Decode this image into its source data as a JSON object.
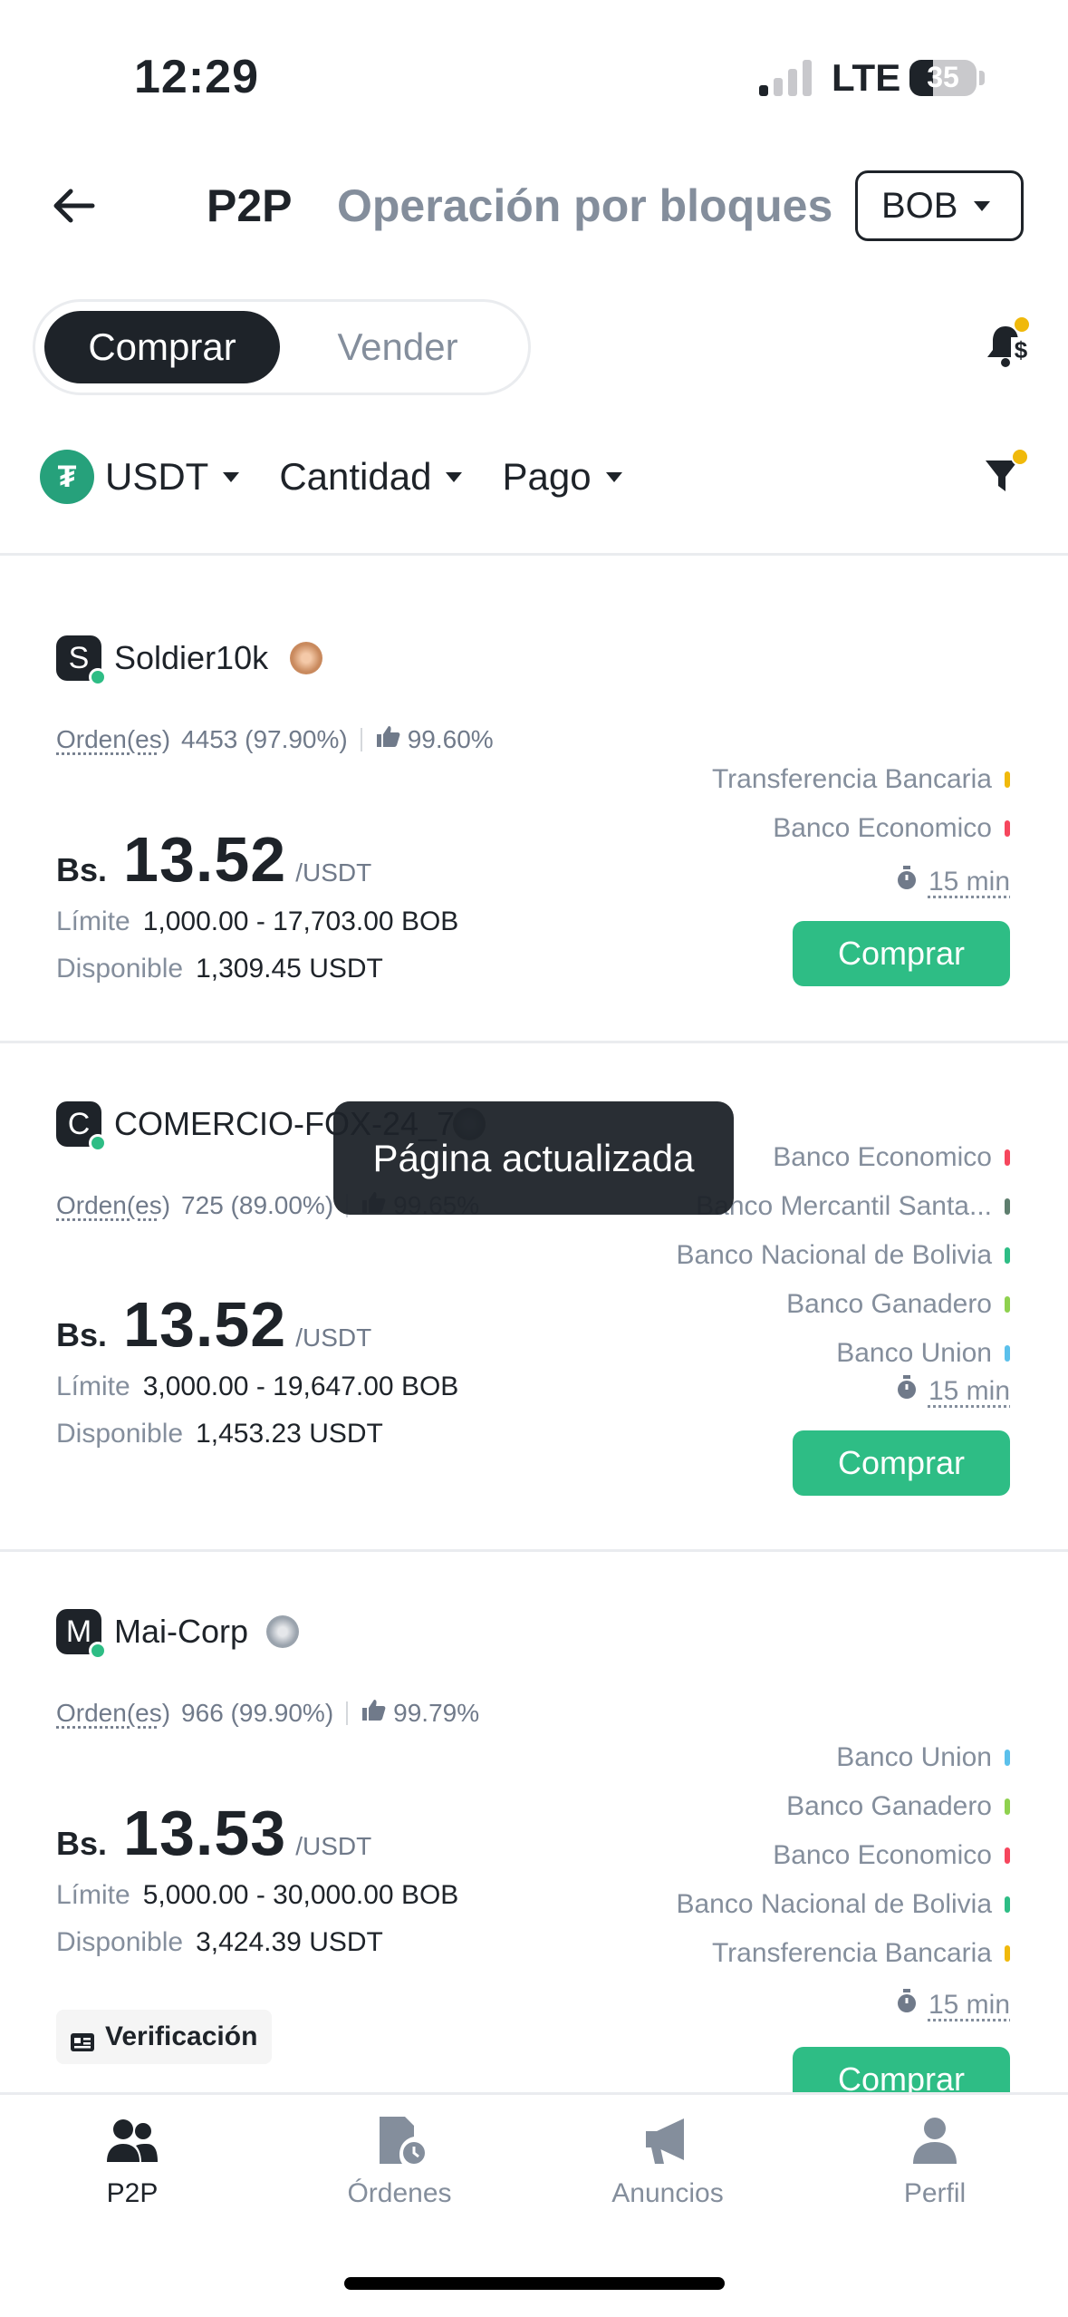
{
  "status_bar": {
    "time": "12:29",
    "network": "LTE",
    "battery": "35",
    "battery_level": 0.35
  },
  "header": {
    "title": "P2P",
    "secondary_tab": "Operación por bloques",
    "currency": "BOB",
    "icons": {
      "back": "arrow-left-icon",
      "notifications": "bell-dollar-icon",
      "filter": "funnel-icon"
    }
  },
  "mode_toggle": {
    "buy": "Comprar",
    "sell": "Vender"
  },
  "filters": {
    "asset": "USDT",
    "amount": "Cantidad",
    "payment": "Pago"
  },
  "ads": [
    {
      "initial": "S",
      "merchant": "Soldier10k",
      "orders_label": "Orden(es)",
      "orders": "4453 (97.90%)",
      "rating": "99.60%",
      "currency": "Bs.",
      "price": "13.52",
      "unit": "/USDT",
      "limit_label": "Límite",
      "limit": "1,000.00 - 17,703.00 BOB",
      "available_label": "Disponible",
      "available": "1,309.45 USDT",
      "payments": [
        {
          "name": "Transferencia Bancaria",
          "color": "#f0b90b"
        },
        {
          "name": "Banco Economico",
          "color": "#f6465d"
        }
      ],
      "time_limit": "15 min",
      "button": "Comprar"
    },
    {
      "initial": "C",
      "merchant": "COMERCIO-FOX-24_7",
      "orders_label": "Orden(es)",
      "orders": "725 (89.00%)",
      "rating": "99.65%",
      "currency": "Bs.",
      "price": "13.52",
      "unit": "/USDT",
      "limit_label": "Límite",
      "limit": "3,000.00 - 19,647.00 BOB",
      "available_label": "Disponible",
      "available": "1,453.23 USDT",
      "payments": [
        {
          "name": "Banco Economico",
          "color": "#f6465d"
        },
        {
          "name": "Banco Mercantil Santa...",
          "color": "#5e7e6e"
        },
        {
          "name": "Banco Nacional de Bolivia",
          "color": "#2ebd85"
        },
        {
          "name": "Banco Ganadero",
          "color": "#8fd14f"
        },
        {
          "name": "Banco Union",
          "color": "#5bc0eb"
        }
      ],
      "time_limit": "15 min",
      "button": "Comprar"
    },
    {
      "initial": "M",
      "merchant": "Mai-Corp",
      "orders_label": "Orden(es)",
      "orders": "966 (99.90%)",
      "rating": "99.79%",
      "currency": "Bs.",
      "price": "13.53",
      "unit": "/USDT",
      "limit_label": "Límite",
      "limit": "5,000.00 - 30,000.00 BOB",
      "available_label": "Disponible",
      "available": "3,424.39 USDT",
      "payments": [
        {
          "name": "Banco Union",
          "color": "#5bc0eb"
        },
        {
          "name": "Banco Ganadero",
          "color": "#8fd14f"
        },
        {
          "name": "Banco Economico",
          "color": "#f6465d"
        },
        {
          "name": "Banco Nacional de Bolivia",
          "color": "#2ebd85"
        },
        {
          "name": "Transferencia Bancaria",
          "color": "#f0b90b"
        }
      ],
      "time_limit": "15 min",
      "button": "Comprar",
      "verification": "Verificación"
    }
  ],
  "toast": "Página actualizada",
  "bottom_nav": [
    {
      "label": "P2P",
      "icon": "users-icon",
      "active": true
    },
    {
      "label": "Órdenes",
      "icon": "orders-clock-icon",
      "active": false
    },
    {
      "label": "Anuncios",
      "icon": "megaphone-icon",
      "active": false
    },
    {
      "label": "Perfil",
      "icon": "person-icon",
      "active": false
    }
  ],
  "colors": {
    "accent_green": "#2ebd85",
    "dark": "#1e2329",
    "muted": "#848e9c",
    "notice_yellow": "#f0b90b"
  }
}
